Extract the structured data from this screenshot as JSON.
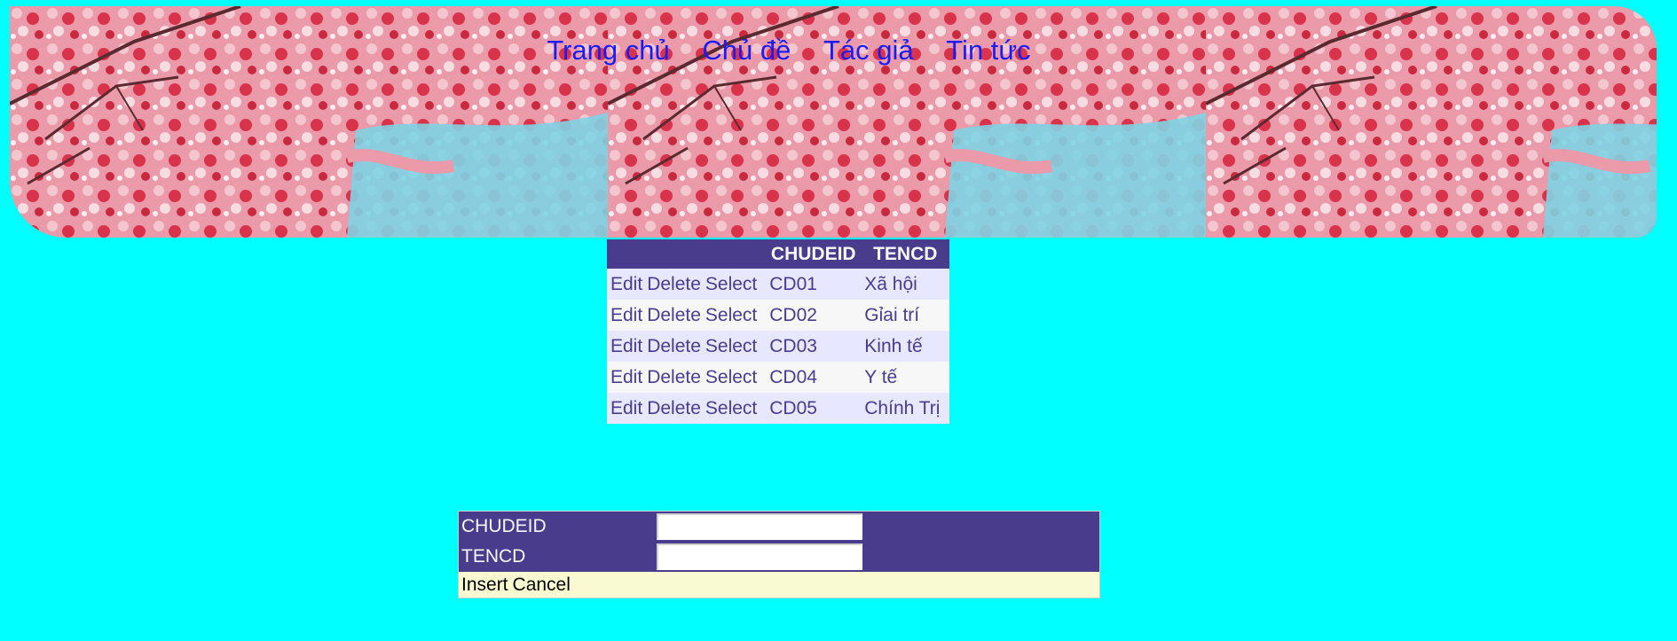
{
  "nav": {
    "items": [
      "Trang chủ",
      "Chủ đề",
      "Tác giả",
      "Tin tức"
    ]
  },
  "grid": {
    "headers": [
      "",
      "CHUDEID",
      "TENCD"
    ],
    "command_labels": {
      "edit": "Edit",
      "delete": "Delete",
      "select": "Select"
    },
    "rows": [
      {
        "chudeid": "CD01",
        "tencd": "Xã hội"
      },
      {
        "chudeid": "CD02",
        "tencd": "Gỉai trí"
      },
      {
        "chudeid": "CD03",
        "tencd": "Kinh tế"
      },
      {
        "chudeid": "CD04",
        "tencd": "Y tế"
      },
      {
        "chudeid": "CD05",
        "tencd": "Chính Trị"
      }
    ]
  },
  "form": {
    "fields": [
      {
        "label": "CHUDEID",
        "value": ""
      },
      {
        "label": "TENCD",
        "value": ""
      }
    ],
    "insert_label": "Insert",
    "cancel_label": "Cancel"
  },
  "colors": {
    "page_background": "#00FFFF",
    "header_background": "#4A3C8C",
    "row_alt_1": "#E7E7FF",
    "row_alt_2": "#F7F7F7",
    "form_command_row": "#FAFAD2",
    "nav_link": "#1A1AFF"
  },
  "icons": {
    "banner": "cherry-blossom-banner"
  }
}
